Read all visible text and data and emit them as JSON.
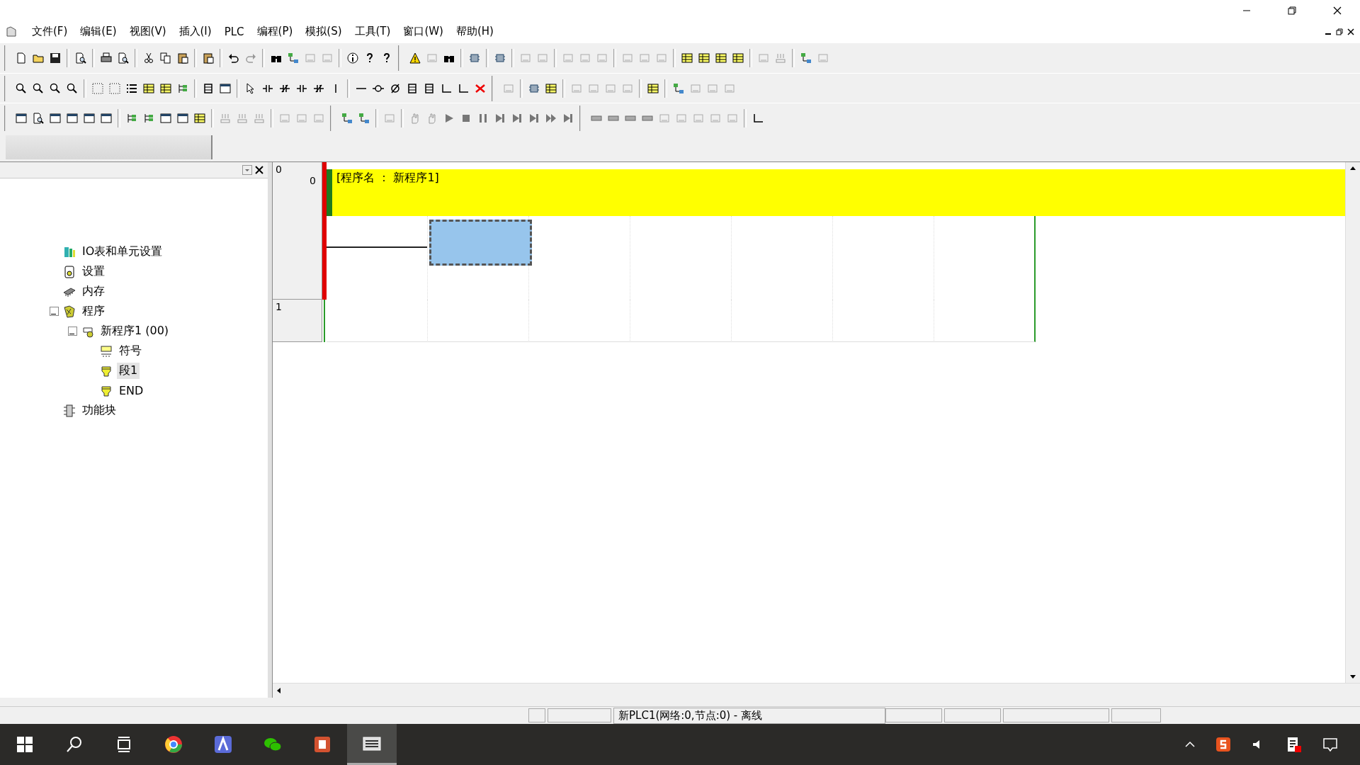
{
  "menu": [
    {
      "label": "文件(F)"
    },
    {
      "label": "编辑(E)"
    },
    {
      "label": "视图(V)"
    },
    {
      "label": "插入(I)"
    },
    {
      "label": "PLC"
    },
    {
      "label": "编程(P)"
    },
    {
      "label": "模拟(S)"
    },
    {
      "label": "工具(T)"
    },
    {
      "label": "窗口(W)"
    },
    {
      "label": "帮助(H)"
    }
  ],
  "tree": [
    {
      "label": "IO表和单元设置",
      "kind": "io",
      "selected": false
    },
    {
      "label": "设置",
      "kind": "settings",
      "selected": false
    },
    {
      "label": "内存",
      "kind": "memory",
      "selected": false
    },
    {
      "label": "程序",
      "kind": "programs",
      "selected": false,
      "expanded": true,
      "children": [
        {
          "label": "新程序1 (00)",
          "kind": "program",
          "selected": false,
          "expanded": true,
          "children": [
            {
              "label": "符号",
              "kind": "symbols",
              "selected": false
            },
            {
              "label": "段1",
              "kind": "section",
              "selected": true
            },
            {
              "label": "END",
              "kind": "section",
              "selected": false
            }
          ]
        }
      ]
    },
    {
      "label": "功能块",
      "kind": "blocks",
      "selected": false
    }
  ],
  "rungs": [
    {
      "number": "0",
      "step": "0",
      "comment": "[程序名 ： 新程序1]",
      "cells": [
        {
          "kind": "wire",
          "selected": false
        },
        {
          "kind": "empty",
          "selected": true
        },
        {
          "kind": "empty",
          "selected": false
        },
        {
          "kind": "empty",
          "selected": false
        },
        {
          "kind": "empty",
          "selected": false
        },
        {
          "kind": "empty",
          "selected": false
        },
        {
          "kind": "empty",
          "selected": false
        }
      ]
    },
    {
      "number": "1",
      "cells": [
        {
          "kind": "empty",
          "selected": false
        },
        {
          "kind": "empty",
          "selected": false
        },
        {
          "kind": "empty",
          "selected": false
        },
        {
          "kind": "empty",
          "selected": false
        },
        {
          "kind": "empty",
          "selected": false
        },
        {
          "kind": "empty",
          "selected": false
        },
        {
          "kind": "empty",
          "selected": false
        }
      ]
    }
  ],
  "status_bar": {
    "text": "新PLC1(网络:0,节点:0) - 离线"
  }
}
